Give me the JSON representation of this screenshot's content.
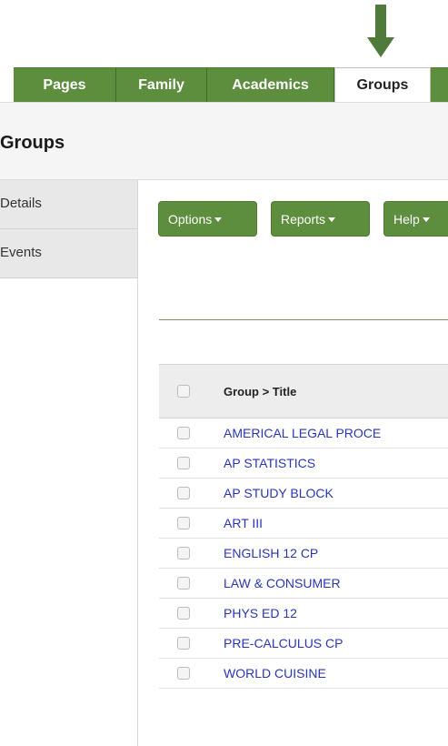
{
  "tabs": [
    {
      "label": "Pages"
    },
    {
      "label": "Family"
    },
    {
      "label": "Academics"
    },
    {
      "label": "Groups"
    }
  ],
  "page_title": "Groups",
  "sidebar": {
    "items": [
      {
        "label": "Details"
      },
      {
        "label": "Events"
      }
    ]
  },
  "toolbar": {
    "options_label": "Options",
    "reports_label": "Reports",
    "help_label": "Help"
  },
  "table": {
    "header": "Group > Title",
    "rows": [
      "AMERICAL LEGAL PROCE",
      "AP STATISTICS",
      "AP STUDY BLOCK",
      "ART III",
      "ENGLISH 12 CP",
      "LAW & CONSUMER",
      "PHYS ED 12",
      "PRE-CALCULUS CP",
      "WORLD CUISINE"
    ]
  },
  "colors": {
    "accent_green": "#5c8e3e",
    "arrow_green": "#4f7b3a",
    "link_blue": "#2936b6"
  },
  "icons": [
    "down-arrow-icon",
    "caret-down-icon",
    "checkbox-icon"
  ]
}
